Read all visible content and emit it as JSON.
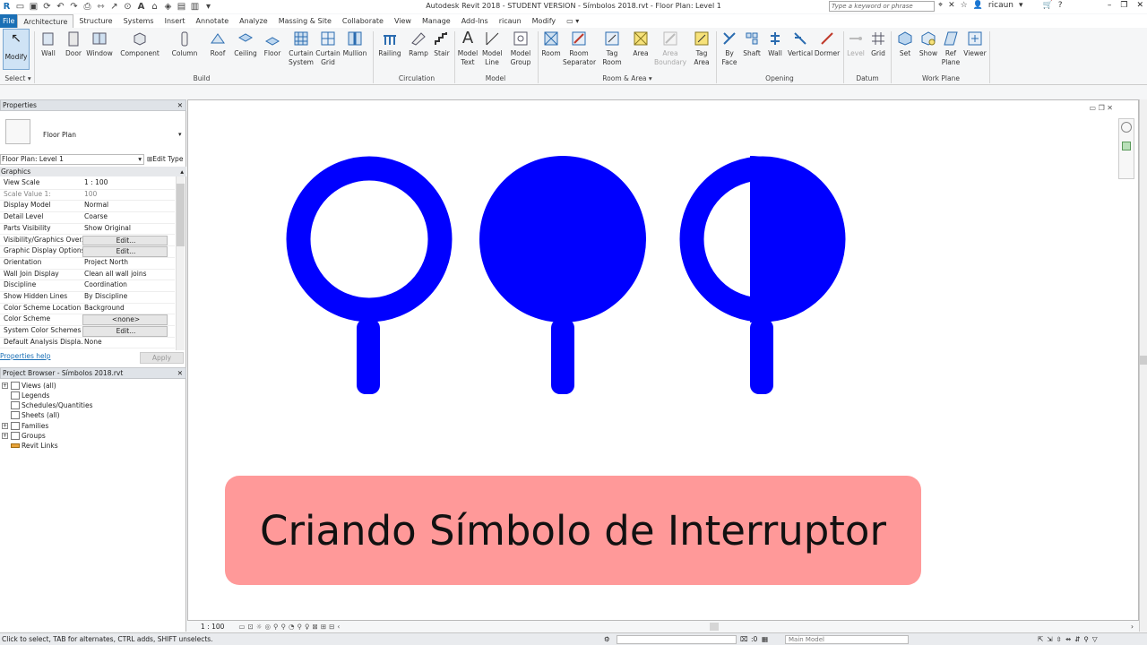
{
  "title_bar": {
    "title": "Autodesk Revit 2018 - STUDENT VERSION -    Símbolos 2018.rvt - Floor Plan: Level 1",
    "search_placeholder": "Type a keyword or phrase",
    "user": "ricaun"
  },
  "menu_tabs": [
    "File",
    "Architecture",
    "Structure",
    "Systems",
    "Insert",
    "Annotate",
    "Analyze",
    "Massing & Site",
    "Collaborate",
    "View",
    "Manage",
    "Add-Ins",
    "ricaun",
    "Modify"
  ],
  "ribbon": {
    "modify_label": "Modify",
    "select_label": "Select",
    "build": [
      "Wall",
      "Door",
      "Window",
      "Component",
      "Column",
      "Roof",
      "Ceiling",
      "Floor",
      "Curtain System",
      "Curtain Grid",
      "Mullion"
    ],
    "build_title": "Build",
    "circulation": [
      "Railing",
      "Ramp",
      "Stair"
    ],
    "circulation_title": "Circulation",
    "model": [
      "Model Text",
      "Model Line",
      "Model Group"
    ],
    "model_title": "Model",
    "room_area": [
      "Room",
      "Room Separator",
      "Tag Room",
      "Area",
      "Area Boundary",
      "Tag Area"
    ],
    "room_area_title": "Room & Area",
    "opening": [
      "By Face",
      "Shaft",
      "Wall",
      "Vertical",
      "Dormer"
    ],
    "opening_title": "Opening",
    "datum": [
      "Level",
      "Grid"
    ],
    "datum_title": "Datum",
    "work_plane": [
      "Set",
      "Show",
      "Ref Plane",
      "Viewer"
    ],
    "work_plane_title": "Work Plane"
  },
  "properties": {
    "title": "Properties",
    "type_name": "Floor Plan",
    "selector": "Floor Plan: Level 1",
    "edit_type": "Edit Type",
    "group": "Graphics",
    "rows": [
      {
        "k": "View Scale",
        "v": "1 : 100"
      },
      {
        "k": "Scale Value    1:",
        "v": "100"
      },
      {
        "k": "Display Model",
        "v": "Normal"
      },
      {
        "k": "Detail Level",
        "v": "Coarse"
      },
      {
        "k": "Parts Visibility",
        "v": "Show Original"
      },
      {
        "k": "Visibility/Graphics Over...",
        "v": "Edit..."
      },
      {
        "k": "Graphic Display Options",
        "v": "Edit..."
      },
      {
        "k": "Orientation",
        "v": "Project North"
      },
      {
        "k": "Wall Join Display",
        "v": "Clean all wall joins"
      },
      {
        "k": "Discipline",
        "v": "Coordination"
      },
      {
        "k": "Show Hidden Lines",
        "v": "By Discipline"
      },
      {
        "k": "Color Scheme Location",
        "v": "Background"
      },
      {
        "k": "Color Scheme",
        "v": "<none>"
      },
      {
        "k": "System Color Schemes",
        "v": "Edit..."
      },
      {
        "k": "Default Analysis Displa...",
        "v": "None"
      }
    ],
    "help": "Properties help",
    "apply": "Apply"
  },
  "browser": {
    "title": "Project Browser - Símbolos 2018.rvt",
    "items": [
      "Views (all)",
      "Legends",
      "Schedules/Quantities",
      "Sheets (all)",
      "Families",
      "Groups",
      "Revit Links"
    ]
  },
  "banner": {
    "text": "Criando Símbolo de Interruptor"
  },
  "view": {
    "scale": "1 : 100"
  },
  "status": {
    "text": "Click to select, TAB for alternates, CTRL adds, SHIFT unselects.",
    "model": "Main Model",
    "zero": ":0"
  },
  "colors": {
    "symbol": "#0000ff",
    "banner": "#ff9999"
  }
}
